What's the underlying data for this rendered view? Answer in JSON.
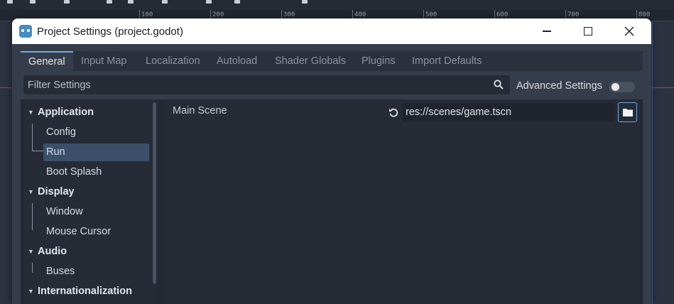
{
  "background": {
    "ruler_labels": [
      "100",
      "200",
      "300",
      "400",
      "500",
      "600",
      "700",
      "800"
    ]
  },
  "window": {
    "title": "Project Settings (project.godot)",
    "app_icon": "godot-icon",
    "controls": [
      "minimize-icon",
      "maximize-icon",
      "close-icon"
    ]
  },
  "tabs": [
    {
      "label": "General",
      "active": true
    },
    {
      "label": "Input Map",
      "active": false
    },
    {
      "label": "Localization",
      "active": false
    },
    {
      "label": "Autoload",
      "active": false
    },
    {
      "label": "Shader Globals",
      "active": false
    },
    {
      "label": "Plugins",
      "active": false
    },
    {
      "label": "Import Defaults",
      "active": false
    }
  ],
  "filter": {
    "placeholder": "Filter Settings",
    "advanced_label": "Advanced Settings",
    "advanced_enabled": false
  },
  "tree": {
    "sections": [
      {
        "label": "Application",
        "children": [
          "Config",
          "Run",
          "Boot Splash"
        ]
      },
      {
        "label": "Display",
        "children": [
          "Window",
          "Mouse Cursor"
        ]
      },
      {
        "label": "Audio",
        "children": [
          "Buses"
        ]
      },
      {
        "label": "Internationalization",
        "children": []
      }
    ],
    "selected": "Run"
  },
  "inspector": {
    "property_label": "Main Scene",
    "property_value": "res://scenes/game.tscn"
  },
  "colors": {
    "accent": "#6fa8e4",
    "selection": "#3b4f6b",
    "panel": "#363d4a"
  }
}
